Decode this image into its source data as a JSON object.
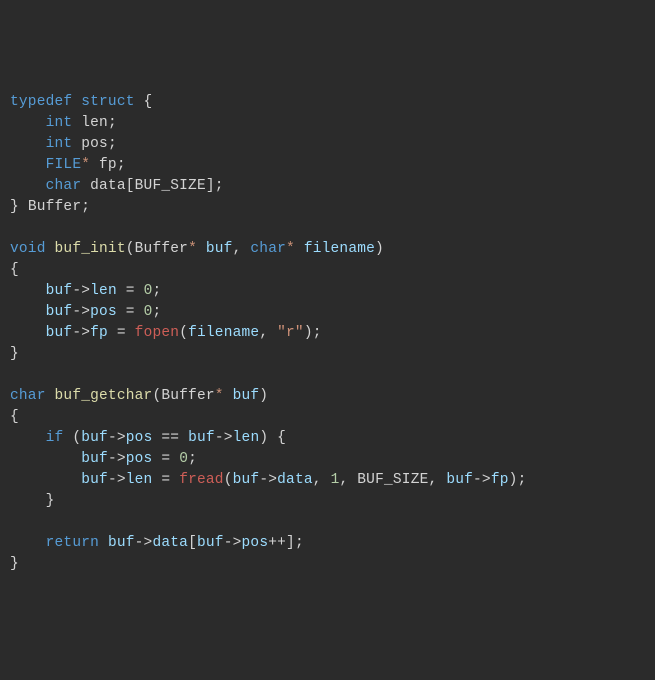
{
  "code": {
    "l1": {
      "kw1": "typedef",
      "kw2": "struct",
      "brace": "{"
    },
    "l2": {
      "type": "int",
      "name": "len",
      "semi": ";"
    },
    "l3": {
      "type": "int",
      "name": "pos",
      "semi": ";"
    },
    "l4": {
      "type": "FILE",
      "star": "*",
      "name": "fp",
      "semi": ";"
    },
    "l5": {
      "type": "char",
      "name": "data",
      "lbrack": "[",
      "const": "BUF_SIZE",
      "rbrack": "]",
      ";": ";"
    },
    "l6": {
      "brace": "}",
      "name": "Buffer",
      "semi": ";"
    },
    "l8": {
      "ret": "void",
      "fn": "buf_init",
      "lpar": "(",
      "t1": "Buffer",
      "s1": "*",
      "p1": "buf",
      "comma": ",",
      "t2": "char",
      "s2": "*",
      "p2": "filename",
      "rpar": ")"
    },
    "l9": {
      "brace": "{"
    },
    "l10": {
      "obj": "buf",
      "arrow": "->",
      "field": "len",
      "eq": "=",
      "val": "0",
      "semi": ";"
    },
    "l11": {
      "obj": "buf",
      "arrow": "->",
      "field": "pos",
      "eq": "=",
      "val": "0",
      "semi": ";"
    },
    "l12": {
      "obj": "buf",
      "arrow": "->",
      "field": "fp",
      "eq": "=",
      "fn": "fopen",
      "lpar": "(",
      "arg1": "filename",
      "comma": ",",
      "str": "\"r\"",
      "rpar": ")",
      "semi": ";"
    },
    "l13": {
      "brace": "}"
    },
    "l15": {
      "ret": "char",
      "fn": "buf_getchar",
      "lpar": "(",
      "t1": "Buffer",
      "s1": "*",
      "p1": "buf",
      "rpar": ")"
    },
    "l16": {
      "brace": "{"
    },
    "l17": {
      "kw": "if",
      "lpar": "(",
      "o1": "buf",
      "a1": "->",
      "f1": "pos",
      "cmp": "==",
      "o2": "buf",
      "a2": "->",
      "f2": "len",
      "rpar": ")",
      "brace": "{"
    },
    "l18": {
      "obj": "buf",
      "arrow": "->",
      "field": "pos",
      "eq": "=",
      "val": "0",
      "semi": ";"
    },
    "l19": {
      "obj": "buf",
      "arrow": "->",
      "field": "len",
      "eq": "=",
      "fn": "fread",
      "lpar": "(",
      "o1": "buf",
      "a1": "->",
      "f1": "data",
      "c1": ",",
      "n1": "1",
      "c2": ",",
      "const": "BUF_SIZE",
      "c3": ",",
      "o2": "buf",
      "a2": "->",
      "f2": "fp",
      "rpar": ")",
      "semi": ";"
    },
    "l20": {
      "brace": "}"
    },
    "l22": {
      "kw": "return",
      "obj": "buf",
      "arrow": "->",
      "field": "data",
      "lb": "[",
      "o2": "buf",
      "a2": "->",
      "f2": "pos",
      "pp": "++",
      "rb": "]",
      "semi": ";"
    },
    "l23": {
      "brace": "}"
    }
  }
}
